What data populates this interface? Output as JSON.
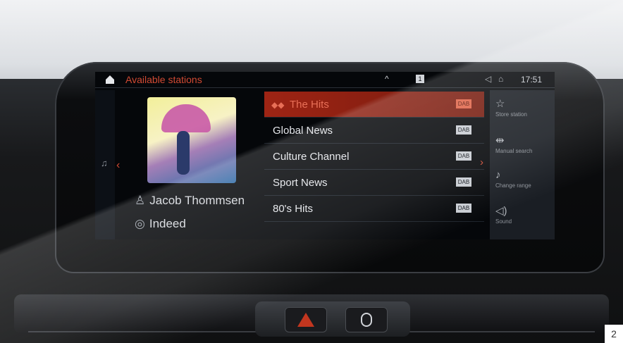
{
  "topbar": {
    "title": "Available stations",
    "up_glyph": "^",
    "source_badge": "1",
    "time": "17:51",
    "icons": [
      "home-icon",
      "chevron-up-icon",
      "speaker-icon",
      "user-icon"
    ]
  },
  "now_playing": {
    "artist": "Jacob Thommsen",
    "album": "Indeed"
  },
  "stations": [
    {
      "name": "The Hits",
      "badge": "DAB",
      "active": true
    },
    {
      "name": "Global News",
      "badge": "DAB",
      "active": false
    },
    {
      "name": "Culture Channel",
      "badge": "DAB",
      "active": false
    },
    {
      "name": "Sport News",
      "badge": "DAB",
      "active": false
    },
    {
      "name": "80's Hits",
      "badge": "DAB",
      "active": false
    }
  ],
  "side_menu": [
    {
      "label": "Store station",
      "icon": "star-icon"
    },
    {
      "label": "Manual search",
      "icon": "tune-icon"
    },
    {
      "label": "Change range",
      "icon": "range-icon"
    },
    {
      "label": "Sound",
      "icon": "sound-icon"
    }
  ],
  "page_number": "2",
  "colors": {
    "accent": "#d24a33",
    "active_row": "#9e2414"
  }
}
